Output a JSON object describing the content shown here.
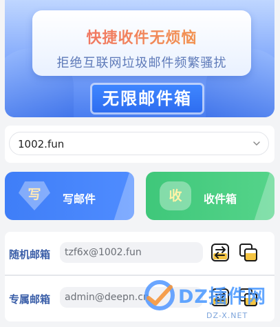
{
  "banner": {
    "headline": "快捷收件无烦恼",
    "subline": "拒绝互联网垃圾邮件频繁骚扰",
    "badge": "无限邮件箱"
  },
  "domain_select": {
    "value": "1002.fun",
    "icon": "chevron-down-icon"
  },
  "actions": {
    "write": {
      "icon_char": "写",
      "label": "写邮件",
      "color": "#4a86f8"
    },
    "inbox": {
      "icon_char": "收",
      "label": "收件箱",
      "color": "#48cd80"
    }
  },
  "mailboxes": [
    {
      "label": "随机邮箱",
      "address": "tzf6x@1002.fun"
    },
    {
      "label": "专属邮箱",
      "address": "admin@deepn.cn"
    }
  ],
  "icons": {
    "swap": "swap-icon",
    "copy": "copy-icon"
  },
  "watermark": {
    "text": "DZ插件网",
    "url": "DZ-X.NET"
  }
}
